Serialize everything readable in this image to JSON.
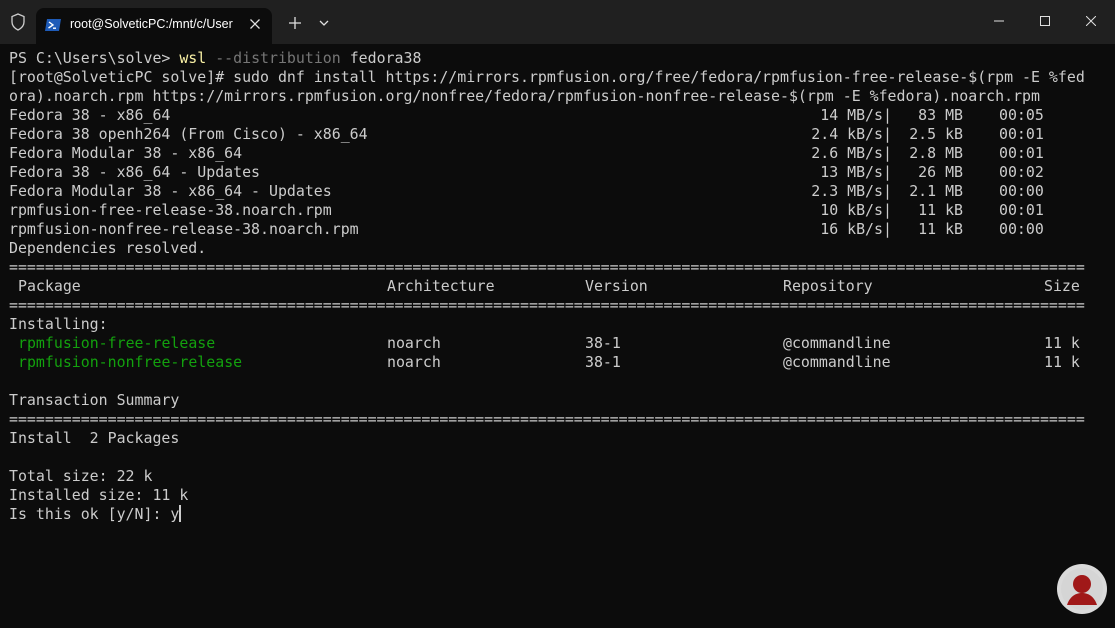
{
  "window": {
    "tab_title": "root@SolveticPC:/mnt/c/User",
    "accent_color": "#1e5bb8"
  },
  "terminal": {
    "prompt_ps": "PS C:\\Users\\solve> ",
    "cmd_wsl": "wsl",
    "cmd_flag": " --distribution",
    "cmd_arg": " fedora38",
    "dnf_line1": "[root@SolveticPC solve]# sudo dnf install https://mirrors.rpmfusion.org/free/fedora/rpmfusion-free-release-$(rpm -E %fed",
    "dnf_line2": "ora).noarch.rpm https://mirrors.rpmfusion.org/nonfree/fedora/rpmfusion-nonfree-release-$(rpm -E %fedora).noarch.rpm",
    "repos": [
      {
        "name": "Fedora 38 - x86_64",
        "speed": "14 MB/s",
        "size": "83 MB",
        "time": "00:05"
      },
      {
        "name": "Fedora 38 openh264 (From Cisco) - x86_64",
        "speed": "2.4 kB/s",
        "size": "2.5 kB",
        "time": "00:01"
      },
      {
        "name": "Fedora Modular 38 - x86_64",
        "speed": "2.6 MB/s",
        "size": "2.8 MB",
        "time": "00:01"
      },
      {
        "name": "Fedora 38 - x86_64 - Updates",
        "speed": "13 MB/s",
        "size": "26 MB",
        "time": "00:02"
      },
      {
        "name": "Fedora Modular 38 - x86_64 - Updates",
        "speed": "2.3 MB/s",
        "size": "2.1 MB",
        "time": "00:00"
      },
      {
        "name": "rpmfusion-free-release-38.noarch.rpm",
        "speed": "10 kB/s",
        "size": "11 kB",
        "time": "00:01"
      },
      {
        "name": "rpmfusion-nonfree-release-38.noarch.rpm",
        "speed": "16 kB/s",
        "size": "11 kB",
        "time": "00:00"
      }
    ],
    "deps_resolved": "Dependencies resolved.",
    "separator": "========================================================================================================================",
    "table_headers": {
      "package": "Package",
      "arch": "Architecture",
      "version": "Version",
      "repo": "Repository",
      "size": "Size"
    },
    "installing_label": "Installing:",
    "packages": [
      {
        "name": "rpmfusion-free-release",
        "arch": "noarch",
        "version": "38-1",
        "repo": "@commandline",
        "size": "11 k"
      },
      {
        "name": "rpmfusion-nonfree-release",
        "arch": "noarch",
        "version": "38-1",
        "repo": "@commandline",
        "size": "11 k"
      }
    ],
    "summary_title": "Transaction Summary",
    "install_count": "Install  2 Packages",
    "total_size": "Total size: 22 k",
    "installed_size": "Installed size: 11 k",
    "confirm_prompt": "Is this ok [y/N]: ",
    "confirm_input": "y"
  }
}
